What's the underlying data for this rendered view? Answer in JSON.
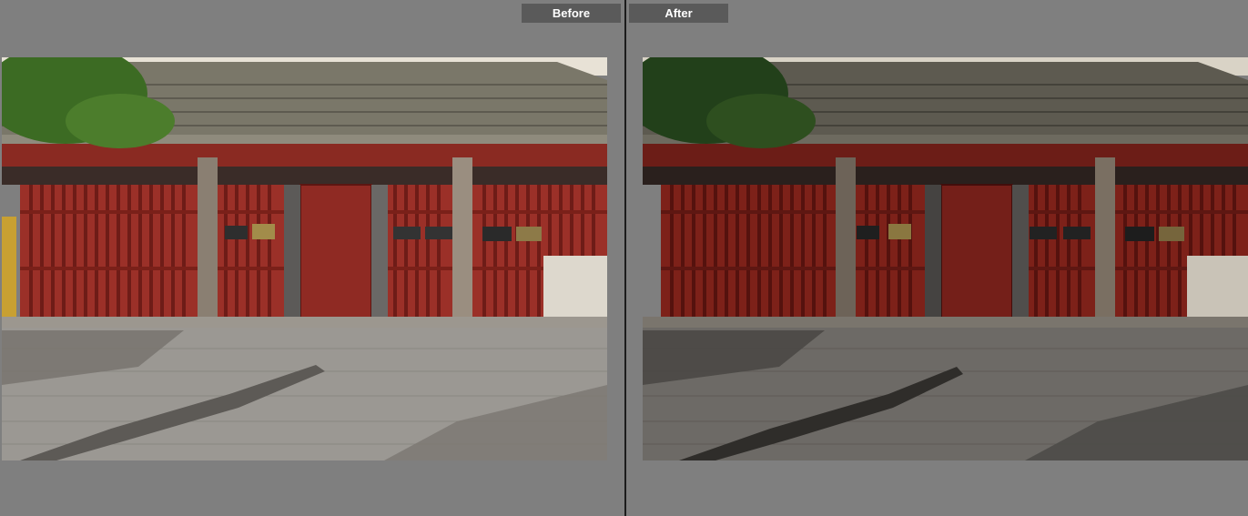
{
  "compare": {
    "before_label": "Before",
    "after_label": "After"
  },
  "photos": {
    "before": {
      "content": "temple-gate-photo"
    },
    "after": {
      "content": "temple-gate-photo-edited"
    }
  },
  "colors": {
    "background": "#808080",
    "label_bg": "#5a5a5a",
    "label_text": "#ffffff",
    "divider": "#1c1c1c"
  }
}
